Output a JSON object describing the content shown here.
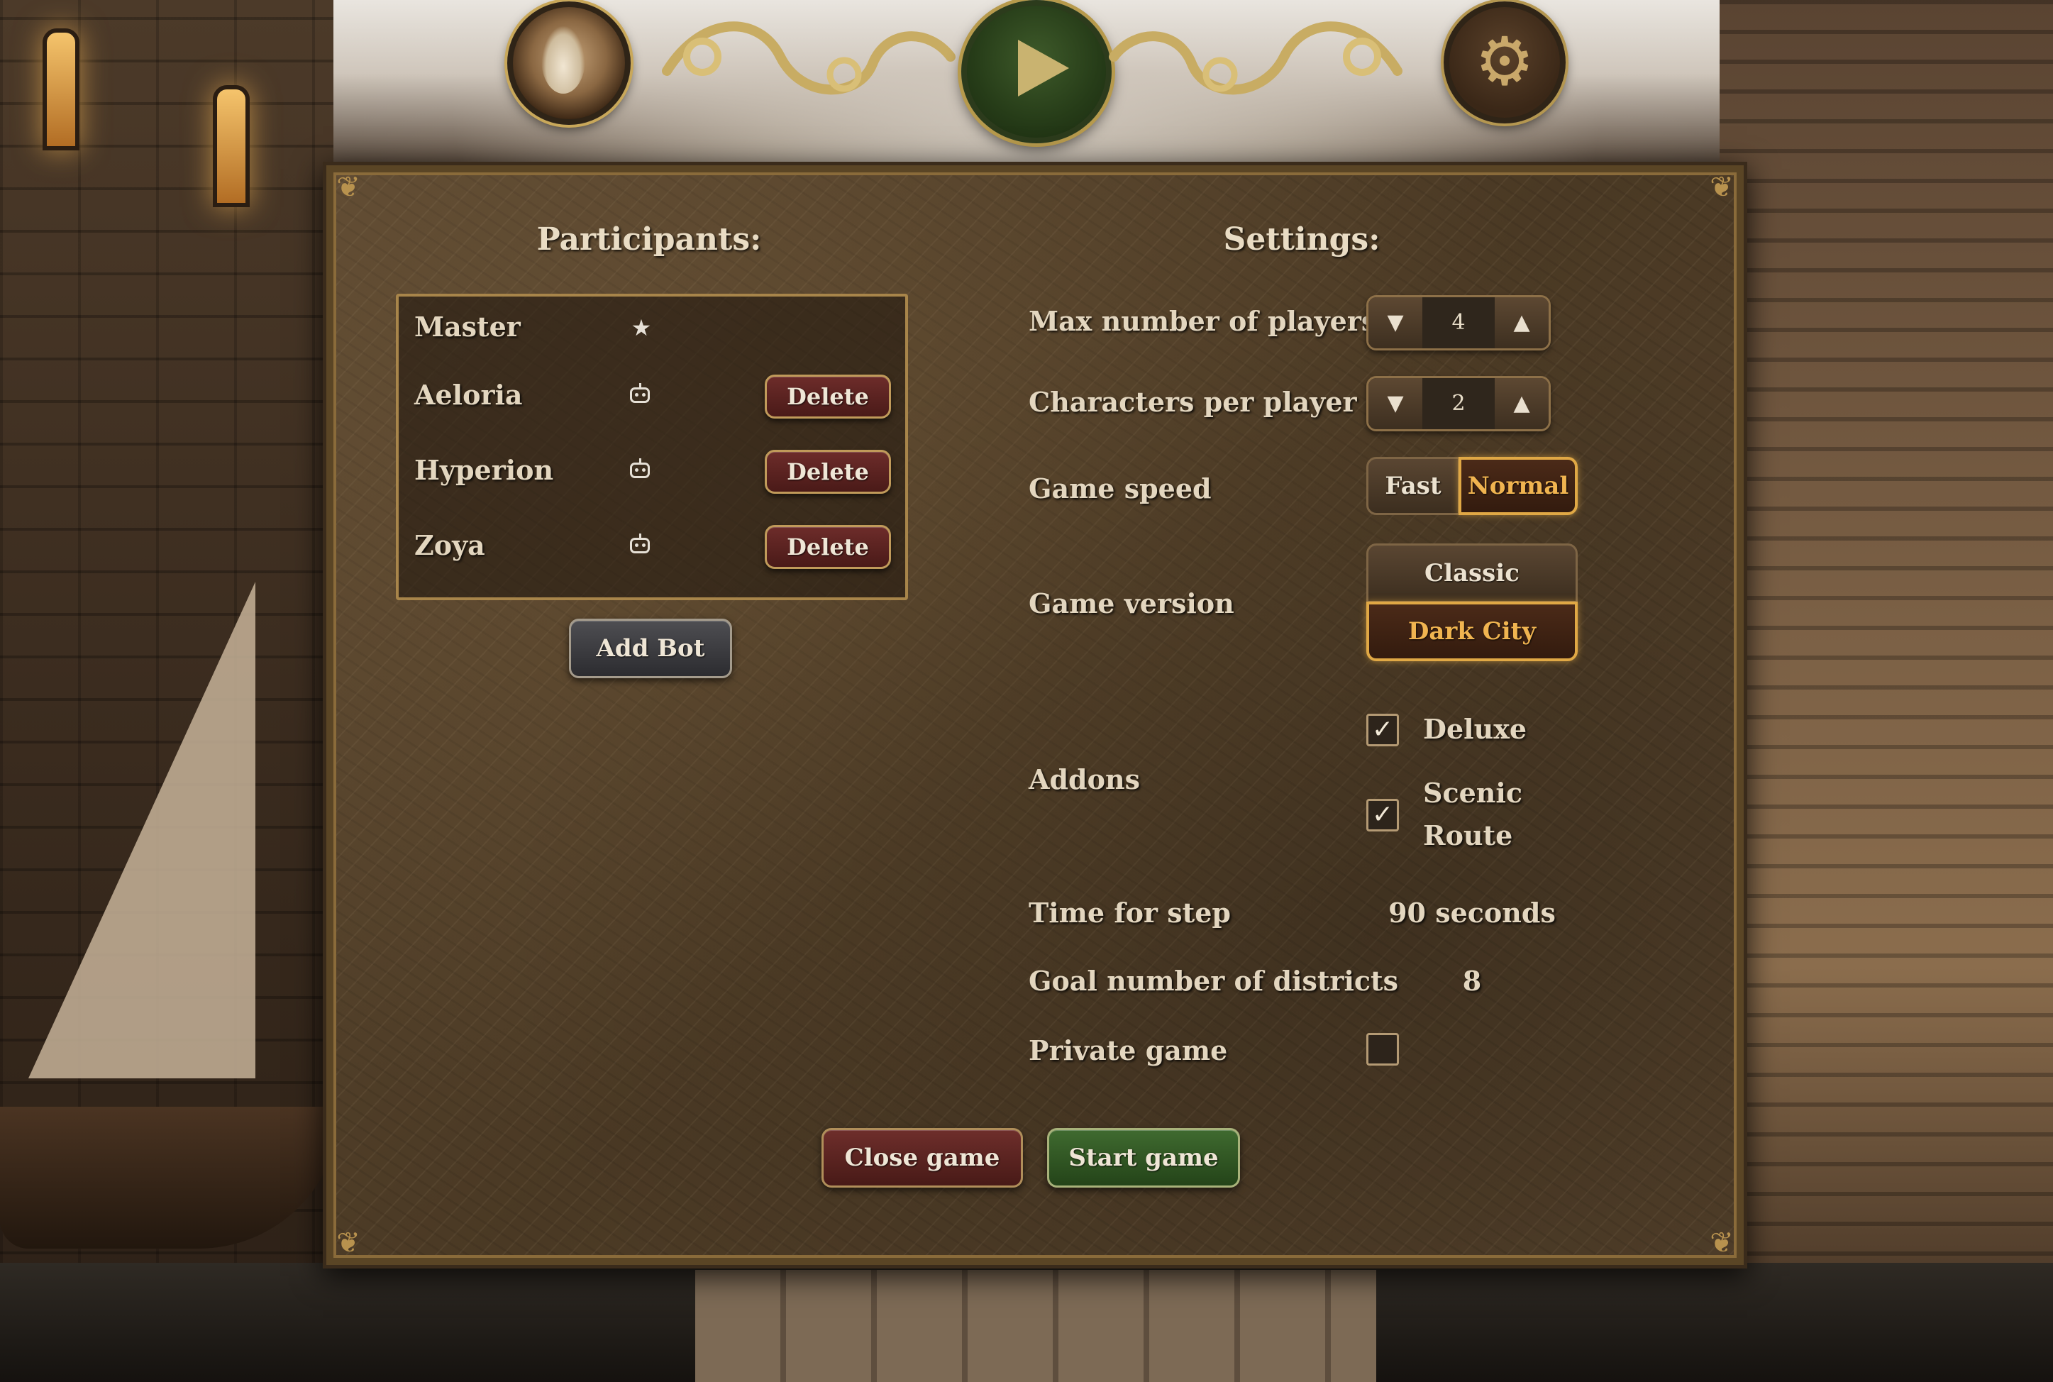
{
  "topbar": {
    "avatar_icon": "wizard-avatar",
    "play_icon": "play-icon",
    "settings_icon": "gear-icon"
  },
  "participants": {
    "heading": "Participants:",
    "rows": [
      {
        "name": "Master",
        "icon": "star-icon",
        "has_delete": false
      },
      {
        "name": "Aeloria",
        "icon": "bot-icon",
        "has_delete": true
      },
      {
        "name": "Hyperion",
        "icon": "bot-icon",
        "has_delete": true
      },
      {
        "name": "Zoya",
        "icon": "bot-icon",
        "has_delete": true
      }
    ],
    "delete_label": "Delete",
    "add_bot_label": "Add Bot"
  },
  "settings": {
    "heading": "Settings:",
    "max_players": {
      "label": "Max number of players",
      "value": "4"
    },
    "characters_per_player": {
      "label": "Characters per player",
      "value": "2"
    },
    "game_speed": {
      "label": "Game speed",
      "options": [
        "Fast",
        "Normal"
      ],
      "selected": "Normal"
    },
    "game_version": {
      "label": "Game version",
      "options": [
        "Classic",
        "Dark City"
      ],
      "selected": "Dark City"
    },
    "addons": {
      "label": "Addons",
      "items": [
        {
          "name": "Deluxe",
          "checked": true
        },
        {
          "name_line1": "Scenic",
          "name_line2": "Route",
          "checked": true
        }
      ]
    },
    "time_for_step": {
      "label": "Time for step",
      "value": "90 seconds"
    },
    "goal_districts": {
      "label": "Goal number of districts",
      "value": "8"
    },
    "private_game": {
      "label": "Private game",
      "checked": false
    }
  },
  "actions": {
    "close_label": "Close game",
    "start_label": "Start game"
  },
  "colors": {
    "accent_gold": "#e0a845",
    "delete_red": "#6d2c2a",
    "start_green": "#3f6a2f"
  }
}
